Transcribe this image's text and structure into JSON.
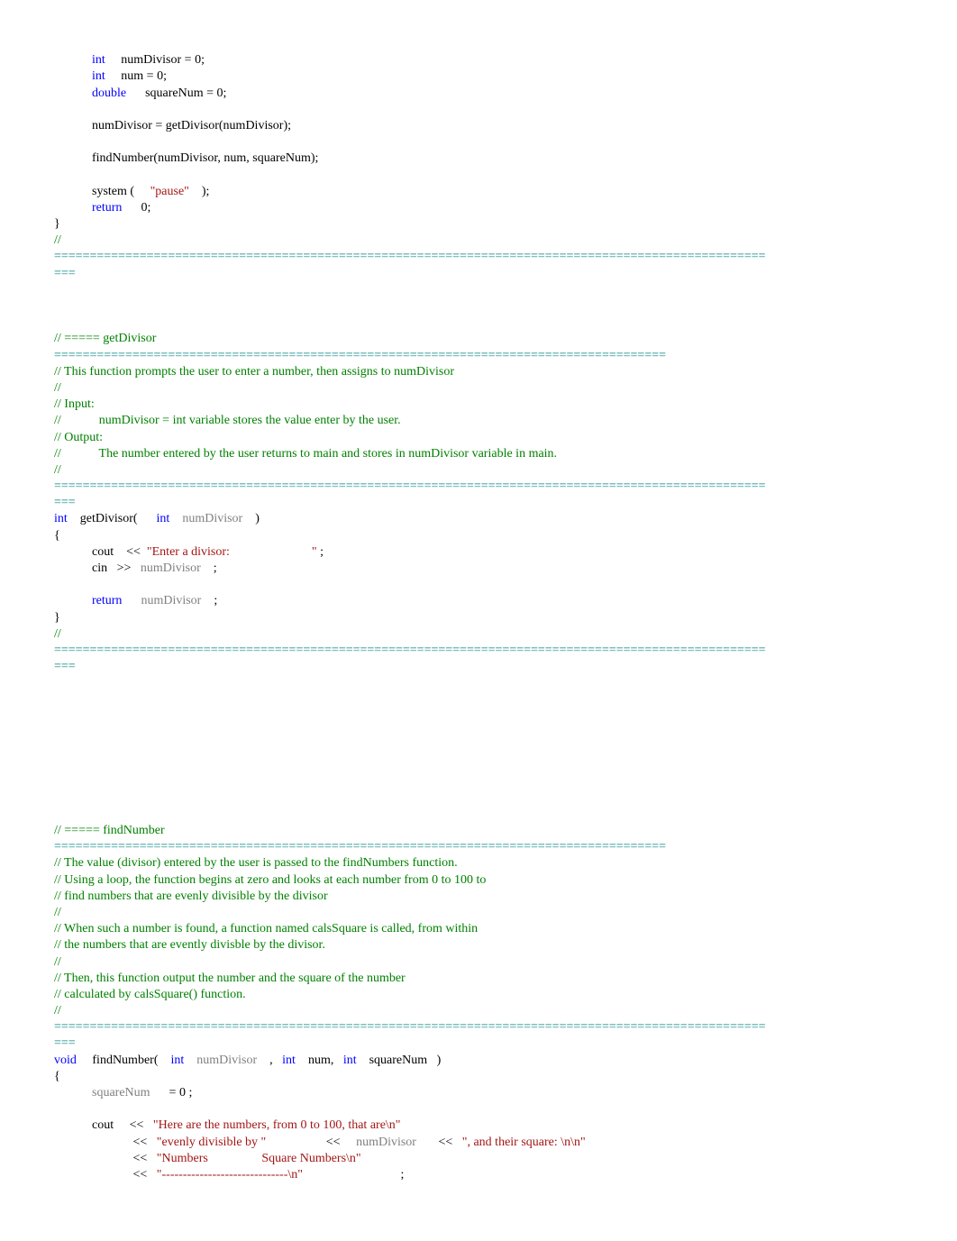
{
  "lines": [
    "",
    "            {kw}int{/kw}     numDivisor = 0;",
    "            {kw}int{/kw}     num = 0;",
    "            {kw}double{/kw}      squareNum = 0;",
    "",
    "            numDivisor = getDivisor(numDivisor);",
    "",
    "            findNumber(numDivisor, num, squareNum);",
    "",
    "            system (     {str}\"pause\"{/str}    );",
    "            {kw}return{/kw}      0;",
    "}",
    "{com}//{/com}",
    "{sep}===================================================================================================={/sep}",
    "{sep}==={/sep}",
    "",
    "",
    "",
    "{com}// ===== getDivisor{/com}",
    "{sep}======================================================================================{/sep}",
    "{com}// This function prompts the user to enter a number, then assigns to numDivisor{/com}",
    "{com}//{/com}",
    "{com}// Input:{/com}",
    "{com}//            numDivisor = int variable stores the value enter by the user.{/com}",
    "{com}// Output:{/com}",
    "{com}//            The number entered by the user returns to main and stores in numDivisor variable in main.{/com}",
    "{com}//{/com}",
    "{sep}===================================================================================================={/sep}",
    "{sep}==={/sep}",
    "{kw}int{/kw}    getDivisor(      {kw}int{/kw}    {ident}numDivisor{/ident}    )",
    "{",
    "            cout    <<  {str}\"Enter a divisor:                          \"{/str} ;",
    "            cin   >>   {ident}numDivisor{/ident}    ;",
    "",
    "            {kw}return{/kw}      {ident}numDivisor{/ident}    ;",
    "}",
    "{com}//{/com}",
    "{sep}===================================================================================================={/sep}",
    "{sep}==={/sep}",
    "",
    "",
    "",
    "",
    "",
    "",
    "",
    "",
    "",
    "{com}// ===== findNumber{/com}",
    "{sep}======================================================================================{/sep}",
    "{com}// The value (divisor) entered by the user is passed to the findNumbers function.{/com}",
    "{com}// Using a loop, the function begins at zero and looks at each number from 0 to 100 to{/com}",
    "{com}// find numbers that are evenly divisible by the divisor{/com}",
    "{com}//{/com}",
    "{com}// When such a number is found, a function named calsSquare is called, from within{/com}",
    "{com}// the numbers that are evently divisble by the divisor.{/com}",
    "{com}//{/com}",
    "{com}// Then, this function output the number and the square of the number{/com}",
    "{com}// calculated by calsSquare() function.{/com}",
    "{com}//{/com}",
    "{sep}===================================================================================================={/sep}",
    "{sep}==={/sep}",
    "{kw}void{/kw}     findNumber(    {kw}int{/kw}    {ident}numDivisor{/ident}    ,   {kw}int{/kw}    num,   {kw}int{/kw}    squareNum   )",
    "{",
    "            {ident}squareNum{/ident}      = 0 ;",
    "",
    "            cout     <<   {str}\"Here are the numbers, from 0 to 100, that are\\n\"{/str}",
    "                         <<   {str}\"evenly divisible by \"{/str}                   <<     {ident}numDivisor{/ident}       <<   {str}\", and their square: \\n\\n\"{/str}",
    "                         <<   {str}\"Numbers                 Square Numbers\\n\"{/str}",
    "                         <<   {str}\"------------------------------\\n\"{/str}                               ;"
  ]
}
